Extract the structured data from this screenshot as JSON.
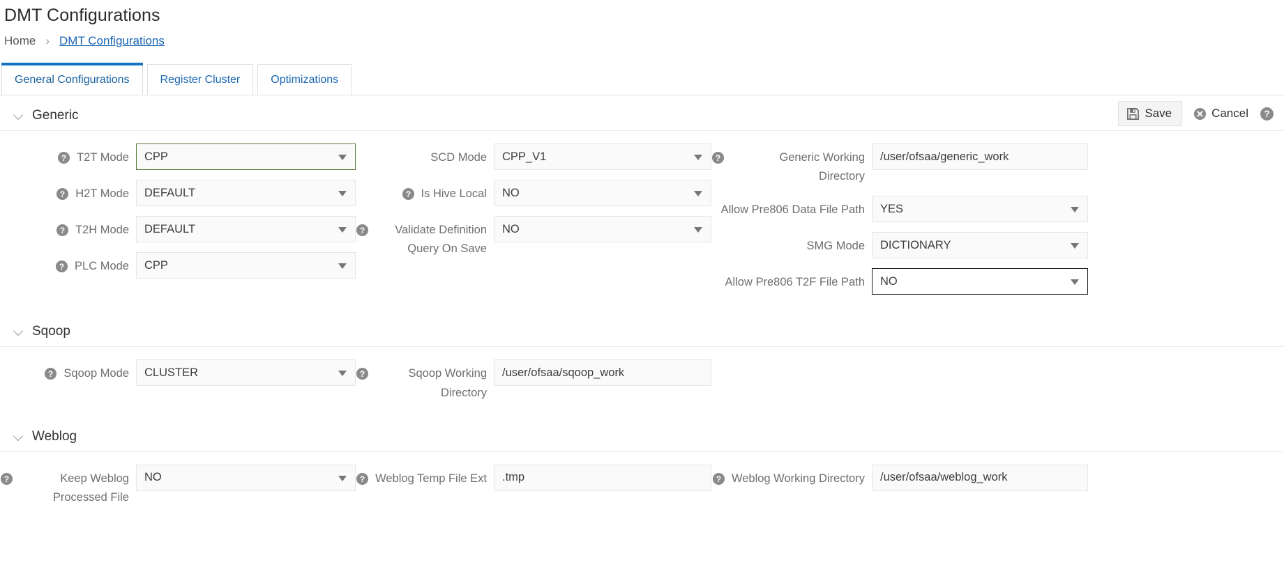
{
  "page": {
    "title": "DMT Configurations"
  },
  "breadcrumb": {
    "home": "Home",
    "separator": "›",
    "current": "DMT Configurations"
  },
  "tabs": [
    {
      "label": "General Configurations",
      "active": true
    },
    {
      "label": "Register Cluster",
      "active": false
    },
    {
      "label": "Optimizations",
      "active": false
    }
  ],
  "toolbar": {
    "save_label": "Save",
    "cancel_label": "Cancel",
    "save_icon": "floppy-disk-icon",
    "cancel_icon": "cancel-circle-icon",
    "help_icon": "help-circle-icon"
  },
  "colors": {
    "accent": "#1673c4",
    "link": "#1a66b3",
    "label": "#6e6e6e",
    "field_bg": "#fafafa",
    "field_border": "#e6e6e6",
    "green_border": "#5b7a3a",
    "focus_border": "#1d1d1d"
  },
  "sections": [
    {
      "id": "generic",
      "title": "Generic",
      "expanded": true,
      "columns": [
        [
          {
            "label": "T2T Mode",
            "help": true,
            "type": "select",
            "value": "CPP",
            "state": "green"
          },
          {
            "label": "H2T Mode",
            "help": true,
            "type": "select",
            "value": "DEFAULT",
            "state": "normal"
          },
          {
            "label": "T2H Mode",
            "help": true,
            "type": "select",
            "value": "DEFAULT",
            "state": "normal"
          },
          {
            "label": "PLC Mode",
            "help": true,
            "type": "select",
            "value": "CPP",
            "state": "normal"
          }
        ],
        [
          {
            "label": "SCD Mode",
            "help": false,
            "type": "select",
            "value": "CPP_V1",
            "state": "normal"
          },
          {
            "label": "Is Hive Local",
            "help": true,
            "type": "select",
            "value": "NO",
            "state": "normal"
          },
          {
            "label": "Validate Definition Query On Save",
            "help": true,
            "type": "select",
            "value": "NO",
            "state": "normal"
          }
        ],
        [
          {
            "label": "Generic Working Directory",
            "help": true,
            "type": "text",
            "value": "/user/ofsaa/generic_work",
            "state": "normal"
          },
          {
            "label": "Allow Pre806 Data File Path",
            "help": false,
            "type": "select",
            "value": "YES",
            "state": "normal"
          },
          {
            "label": "SMG Mode",
            "help": false,
            "type": "select",
            "value": "DICTIONARY",
            "state": "normal"
          },
          {
            "label": "Allow Pre806 T2F File Path",
            "help": false,
            "type": "select",
            "value": "NO",
            "state": "focusdark"
          }
        ]
      ]
    },
    {
      "id": "sqoop",
      "title": "Sqoop",
      "expanded": true,
      "columns": [
        [
          {
            "label": "Sqoop Mode",
            "help": true,
            "type": "select",
            "value": "CLUSTER",
            "state": "normal"
          }
        ],
        [
          {
            "label": "Sqoop Working Directory",
            "help": true,
            "type": "text",
            "value": "/user/ofsaa/sqoop_work",
            "state": "normal"
          }
        ],
        []
      ]
    },
    {
      "id": "weblog",
      "title": "Weblog",
      "expanded": true,
      "columns": [
        [
          {
            "label": "Keep Weblog Processed File",
            "help": true,
            "type": "select",
            "value": "NO",
            "state": "normal"
          }
        ],
        [
          {
            "label": "Weblog Temp File Ext",
            "help": true,
            "type": "text",
            "value": ".tmp",
            "state": "normal"
          }
        ],
        [
          {
            "label": "Weblog Working Directory",
            "help": true,
            "type": "text",
            "value": "/user/ofsaa/weblog_work",
            "state": "normal"
          }
        ]
      ]
    }
  ]
}
